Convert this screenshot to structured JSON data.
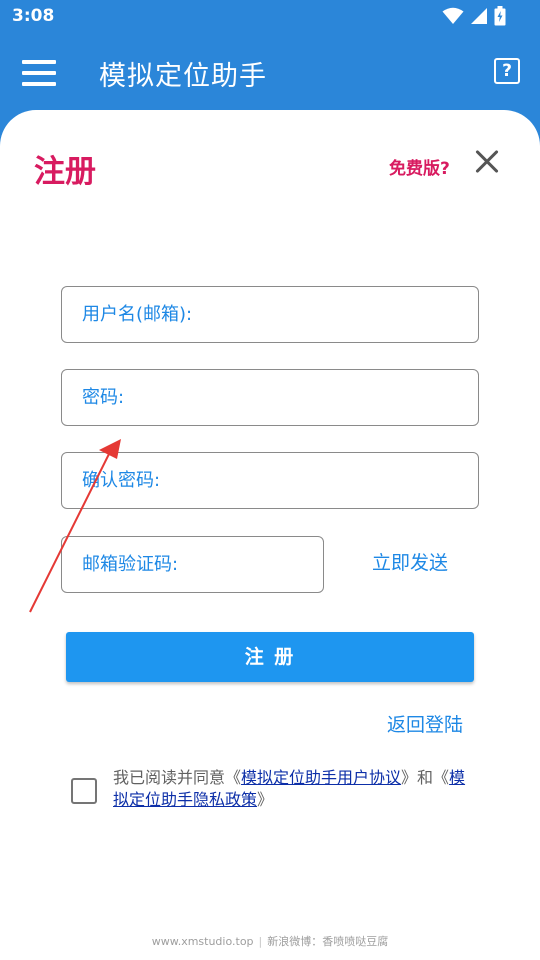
{
  "status_bar": {
    "time": "3:08"
  },
  "app_bar": {
    "title": "模拟定位助手",
    "help_label": "?"
  },
  "sheet": {
    "title": "注册",
    "free_version": "免费版?",
    "fields": {
      "username_placeholder": "用户名(邮箱):",
      "password_placeholder": "密码:",
      "confirm_placeholder": "确认密码:",
      "code_placeholder": "邮箱验证码:"
    },
    "send_now": "立即发送",
    "submit": "注 册",
    "back_login": "返回登陆",
    "agreement": {
      "prefix": "我已阅读并同意《",
      "user_agreement": "模拟定位助手用户协议",
      "middle": "》和《",
      "privacy_policy": "模拟定位助手隐私政策",
      "suffix": "》",
      "checked": false
    }
  },
  "footer": {
    "site": "www.xmstudio.top",
    "separator": "|",
    "weibo": "新浪微博：香喷喷哒豆腐"
  },
  "colors": {
    "primary": "#2b86d9",
    "accent": "#d81b60",
    "button": "#1e96f0",
    "link": "#1e88e5"
  }
}
